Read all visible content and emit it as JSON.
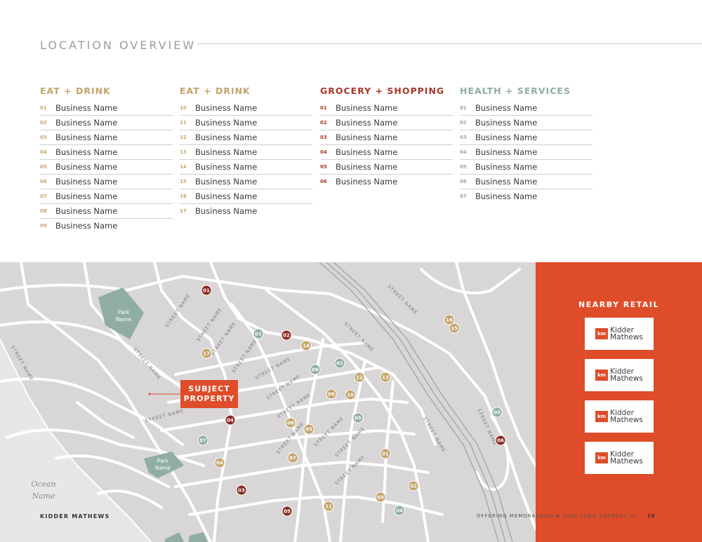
{
  "page": {
    "title": "LOCATION OVERVIEW",
    "footer_left": "KIDDER MATHEWS",
    "footer_right": "OFFERING MEMORANDUM  ▪  0000 LONG ADDRESS ST",
    "page_number": "10"
  },
  "categories": [
    {
      "title": "EAT + DRINK",
      "color": "#c4a46b",
      "items": [
        {
          "num": "01",
          "name": "Business Name"
        },
        {
          "num": "02",
          "name": "Business Name"
        },
        {
          "num": "03",
          "name": "Business Name"
        },
        {
          "num": "04",
          "name": "Business Name"
        },
        {
          "num": "05",
          "name": "Business Name"
        },
        {
          "num": "06",
          "name": "Business Name"
        },
        {
          "num": "07",
          "name": "Business Name"
        },
        {
          "num": "08",
          "name": "Business Name"
        },
        {
          "num": "09",
          "name": "Business Name"
        }
      ]
    },
    {
      "title": "EAT + DRINK",
      "color": "#c4a46b",
      "items": [
        {
          "num": "10",
          "name": "Business Name"
        },
        {
          "num": "11",
          "name": "Business Name"
        },
        {
          "num": "12",
          "name": "Business Name"
        },
        {
          "num": "13",
          "name": "Business Name"
        },
        {
          "num": "14",
          "name": "Business Name"
        },
        {
          "num": "15",
          "name": "Business Name"
        },
        {
          "num": "16",
          "name": "Business Name"
        },
        {
          "num": "17",
          "name": "Business Name"
        }
      ]
    },
    {
      "title": "GROCERY + SHOPPING",
      "color": "#a8372b",
      "items": [
        {
          "num": "01",
          "name": "Business Name"
        },
        {
          "num": "02",
          "name": "Business Name"
        },
        {
          "num": "03",
          "name": "Business Name"
        },
        {
          "num": "04",
          "name": "Business Name"
        },
        {
          "num": "05",
          "name": "Business Name"
        },
        {
          "num": "06",
          "name": "Business Name"
        }
      ]
    },
    {
      "title": "HEALTH + SERVICES",
      "color": "#8fada4",
      "items": [
        {
          "num": "01",
          "name": "Business Name"
        },
        {
          "num": "02",
          "name": "Business Name"
        },
        {
          "num": "03",
          "name": "Business Name"
        },
        {
          "num": "04",
          "name": "Business Name"
        },
        {
          "num": "05",
          "name": "Business Name"
        },
        {
          "num": "06",
          "name": "Business Name"
        },
        {
          "num": "07",
          "name": "Business Name"
        }
      ]
    }
  ],
  "map": {
    "subject_line1": "SUBJECT",
    "subject_line2": "PROPERTY",
    "park_label_1": "Park",
    "park_label_2": "Name",
    "ocean_label_1": "Ocean",
    "ocean_label_2": "Name",
    "street_label": "STREET NAME",
    "colors": {
      "eat": "#c4a46b",
      "grocery": "#8a2a22",
      "health": "#8fada4",
      "map_bg": "#d8d6d6",
      "ocean": "#e6e8e8",
      "park": "#8fada4"
    },
    "pins_eat": [
      "17",
      "14",
      "12",
      "13",
      "09",
      "10",
      "08",
      "05",
      "07",
      "04",
      "01",
      "02",
      "03",
      "11",
      "16",
      "15"
    ],
    "pins_grocery": [
      "01",
      "02",
      "04",
      "03",
      "05",
      "06"
    ],
    "pins_health": [
      "01",
      "06",
      "02",
      "05",
      "07",
      "03",
      "04"
    ]
  },
  "retail": {
    "title": "NEARBY RETAIL",
    "logos": [
      {
        "mark": "km",
        "line1": "Kidder",
        "line2": "Mathews"
      },
      {
        "mark": "km",
        "line1": "Kidder",
        "line2": "Mathews"
      },
      {
        "mark": "km",
        "line1": "Kidder",
        "line2": "Mathews"
      },
      {
        "mark": "km",
        "line1": "Kidder",
        "line2": "Mathews"
      }
    ]
  }
}
